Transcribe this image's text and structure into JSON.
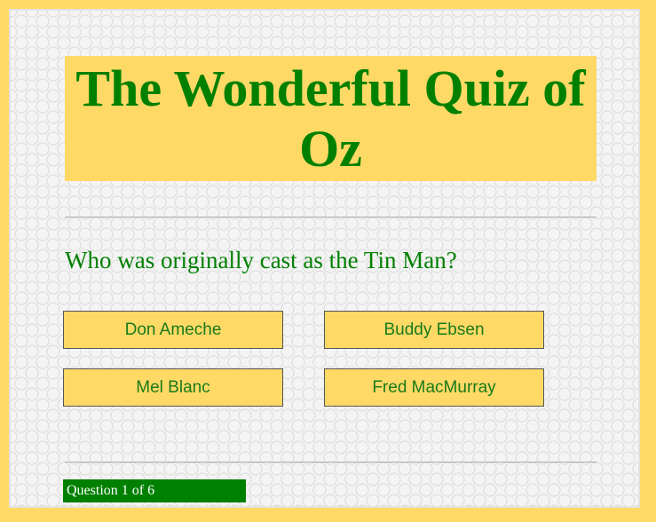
{
  "quiz": {
    "title": "The Wonderful Quiz of Oz",
    "question": "Who was originally cast as the Tin Man?",
    "answers": [
      "Don Ameche",
      "Buddy Ebsen",
      "Mel Blanc",
      "Fred MacMurray"
    ],
    "progress": "Question 1 of 6"
  },
  "colors": {
    "accent_yellow": "#ffd966",
    "text_green": "#008000",
    "progress_bg": "#008000"
  }
}
